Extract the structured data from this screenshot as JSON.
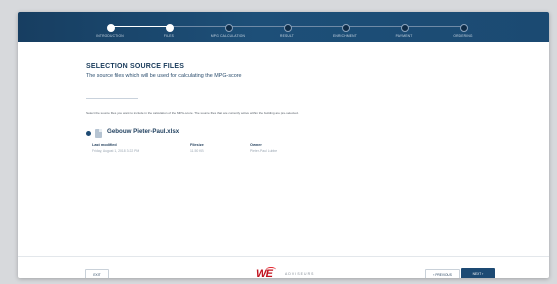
{
  "stepper": {
    "steps": [
      {
        "label": "Introduction",
        "done": true
      },
      {
        "label": "Files",
        "done": true
      },
      {
        "label": "MPG calculation",
        "done": false
      },
      {
        "label": "Result",
        "done": false
      },
      {
        "label": "Enrichment",
        "done": false
      },
      {
        "label": "Payment",
        "done": false
      },
      {
        "label": "Ordering",
        "done": false
      }
    ]
  },
  "main": {
    "title": "SELECTION SOURCE FILES",
    "subtitle": "The source files which will be used for calculating the MPG-score",
    "instructions": "Select the source files you want to include in the calculation of the MPG-score. The source files that are currently active within the building are pre-selected.",
    "file": {
      "name": "Gebouw Pieter-Paul.xlsx",
      "meta": [
        {
          "key": "Last modified",
          "value": "Friday, August 1, 2018 3:22 PM"
        },
        {
          "key": "Filesize",
          "value": "11.50 KB"
        },
        {
          "key": "Owner",
          "value": "Pieter-Paul Lubbe"
        }
      ]
    }
  },
  "footer": {
    "exit_label": "EXIT",
    "logo_mark": "WE",
    "logo_word": "ADVISEURS",
    "prev_label": "PREVIOUS",
    "next_label": "NEXT",
    "prev_arrow": "‹",
    "next_arrow": "›"
  },
  "colors": {
    "header": "#1b4a72",
    "accent": "#1d4a73",
    "brand_red": "#c1131f"
  }
}
